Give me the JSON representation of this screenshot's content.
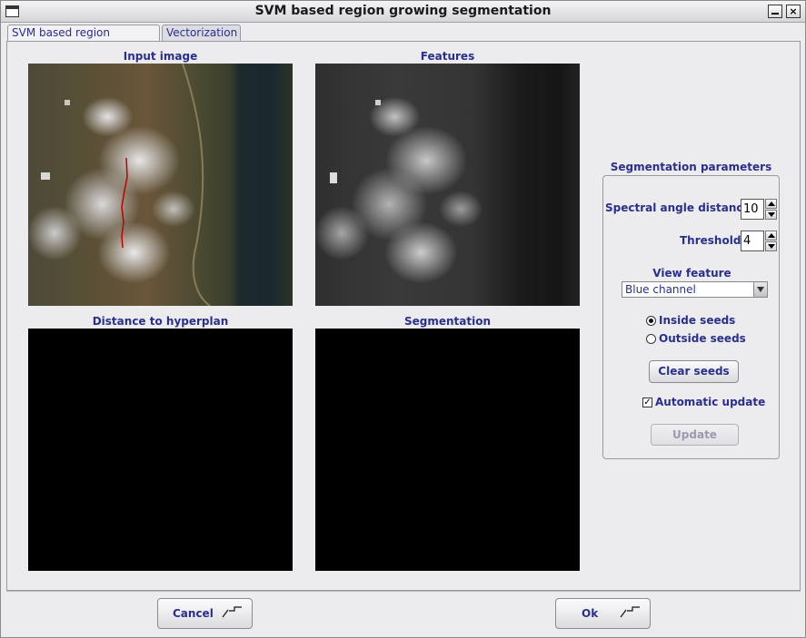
{
  "window": {
    "title": "SVM based region growing segmentation",
    "minimize_symbol": "_",
    "close_symbol": "×"
  },
  "tabs": [
    {
      "label": "SVM based region growing",
      "active": true
    },
    {
      "label": "Vectorization",
      "active": false
    }
  ],
  "panels": {
    "input_image": {
      "label": "Input image"
    },
    "features": {
      "label": "Features"
    },
    "distance": {
      "label": "Distance to hyperplan"
    },
    "segmentation": {
      "label": "Segmentation"
    }
  },
  "params": {
    "group_title": "Segmentation parameters",
    "spectral_angle": {
      "label": "Spectral angle distances",
      "value": "10"
    },
    "thresholds": {
      "label": "Thresholds",
      "value": "4"
    },
    "view_feature": {
      "label": "View feature",
      "selected": "Blue channel"
    },
    "seeds": {
      "inside_label": "Inside seeds",
      "outside_label": "Outside seeds",
      "selected": "inside"
    },
    "clear_seeds_label": "Clear seeds",
    "automatic_update": {
      "label": "Automatic update",
      "checked": true,
      "mark": "✓"
    },
    "update_label": "Update"
  },
  "footer": {
    "cancel_label": "Cancel",
    "ok_label": "Ok"
  },
  "colors": {
    "label_text": "#2a2e8c",
    "seed_stroke": "#c00000"
  }
}
